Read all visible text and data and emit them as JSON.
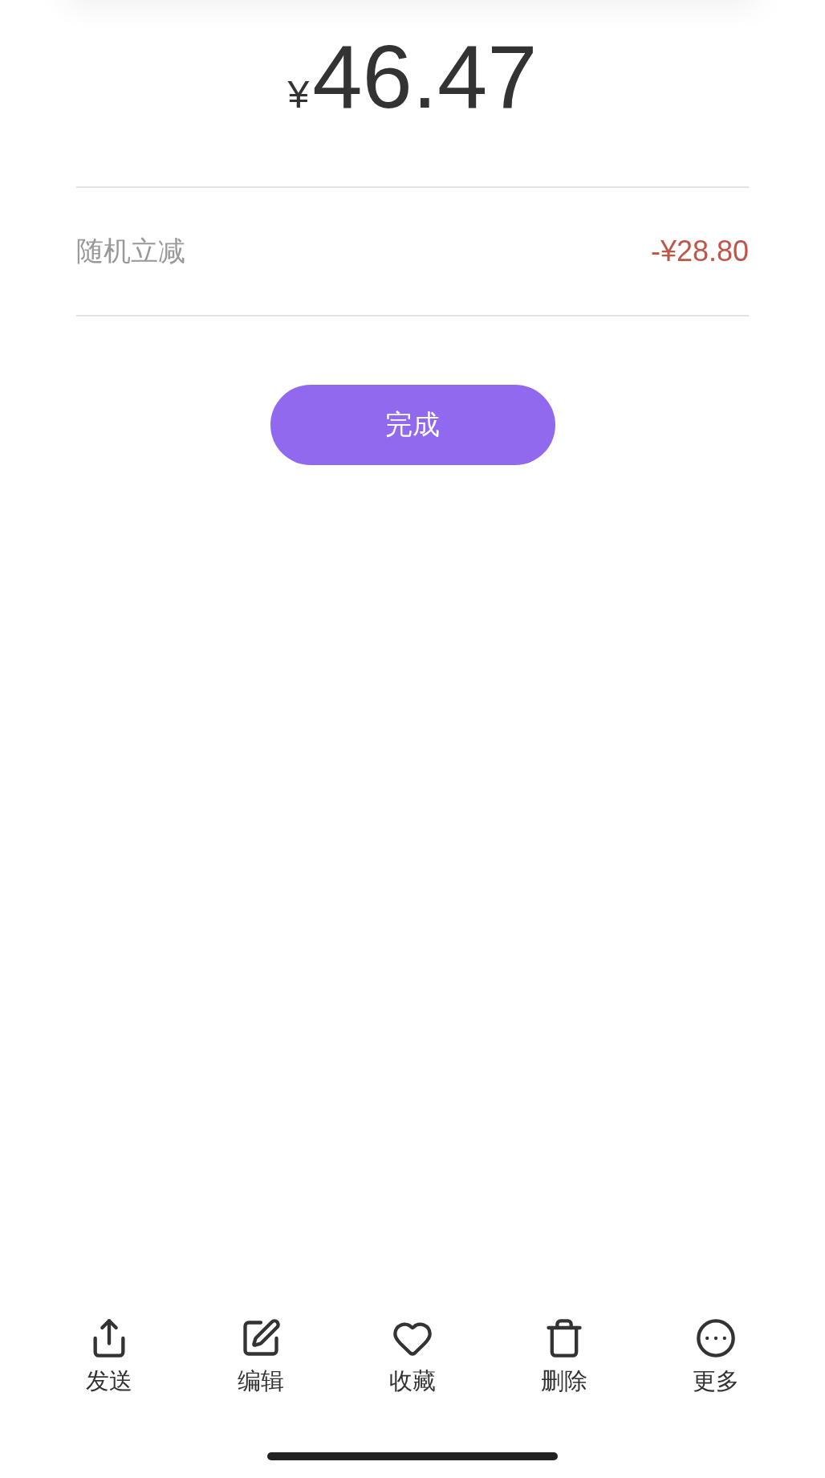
{
  "amount": {
    "currency": "¥",
    "value": "46.47"
  },
  "discount": {
    "label": "随机立减",
    "value": "-¥28.80"
  },
  "done_button": {
    "label": "完成"
  },
  "actions": [
    {
      "kind": "share",
      "label": "发送"
    },
    {
      "kind": "edit",
      "label": "编辑"
    },
    {
      "kind": "favorite",
      "label": "收藏"
    },
    {
      "kind": "delete",
      "label": "删除"
    },
    {
      "kind": "more",
      "label": "更多"
    }
  ]
}
